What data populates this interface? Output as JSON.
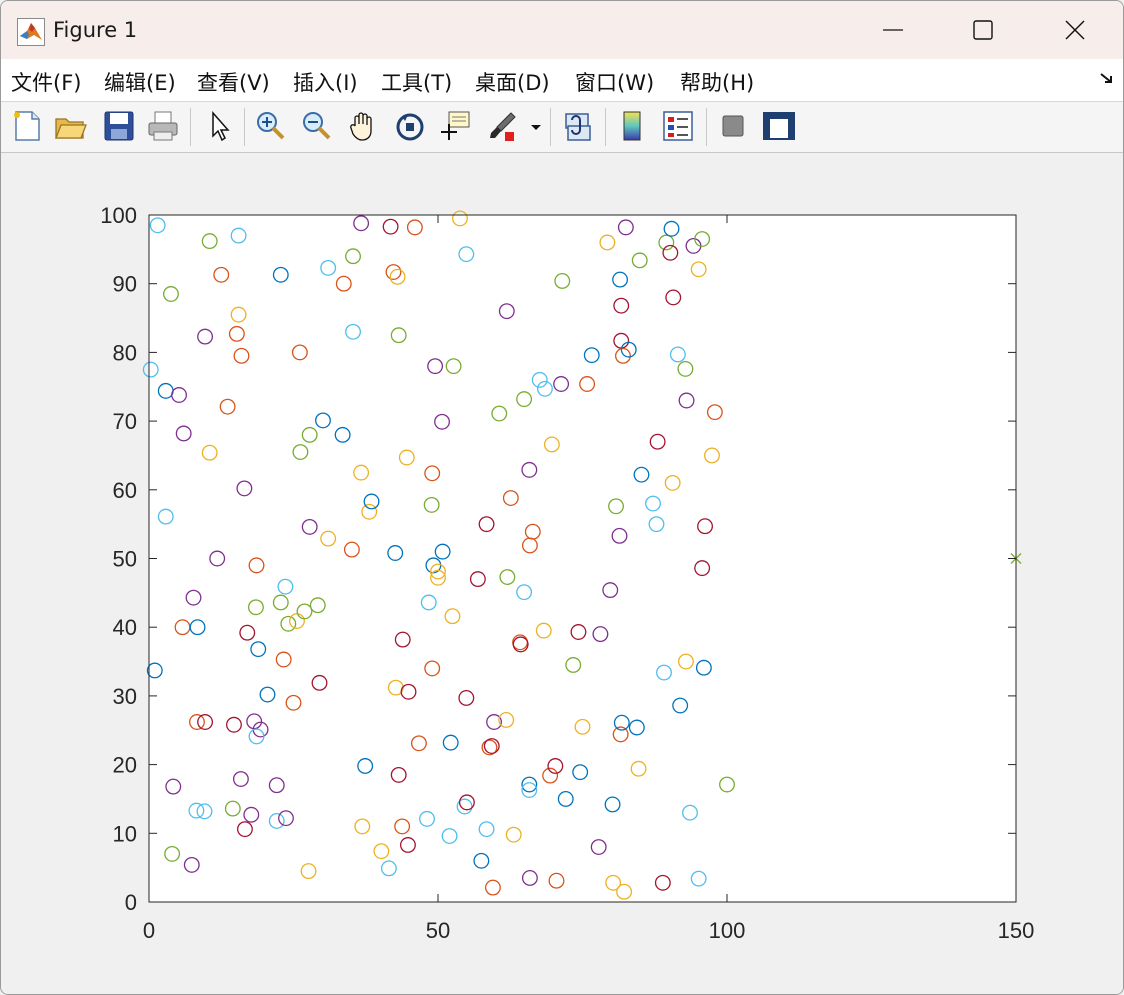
{
  "window": {
    "title": "Figure 1",
    "icon": "matlab-icon",
    "controls": [
      "minimize-icon",
      "maximize-icon",
      "close-icon"
    ]
  },
  "menubar": {
    "items": [
      "文件(F)",
      "编辑(E)",
      "查看(V)",
      "插入(I)",
      "工具(T)",
      "桌面(D)",
      "窗口(W)",
      "帮助(H)"
    ],
    "collapse_icon": "dock-arrow-icon"
  },
  "toolbar": {
    "buttons": [
      "new-figure-icon",
      "open-file-icon",
      "save-icon",
      "print-icon",
      "edit-plot-icon",
      "zoom-in-icon",
      "zoom-out-icon",
      "pan-icon",
      "rotate-3d-icon",
      "data-cursor-icon",
      "brush-icon",
      "link-plot-icon",
      "colorbar-icon",
      "legend-icon",
      "hide-plot-tools-icon",
      "show-plot-tools-icon"
    ]
  },
  "chart_data": {
    "type": "scatter",
    "title": "",
    "xlabel": "",
    "ylabel": "",
    "xlim": [
      0,
      150
    ],
    "ylim": [
      0,
      100
    ],
    "xticks": [
      "0",
      "50",
      "100",
      "150"
    ],
    "yticks": [
      "0",
      "10",
      "20",
      "30",
      "40",
      "50",
      "60",
      "70",
      "80",
      "90",
      "100"
    ],
    "grid": false,
    "marker": "circle",
    "colors": [
      "#0072BD",
      "#D95319",
      "#EDB120",
      "#7E2F8E",
      "#77AC30",
      "#4DBEEE",
      "#A2142F"
    ],
    "points": [
      [
        1.5,
        98.5,
        5
      ],
      [
        10.5,
        96.2,
        4
      ],
      [
        15.5,
        97,
        5
      ],
      [
        22.8,
        91.3,
        0
      ],
      [
        12.5,
        91.3,
        1
      ],
      [
        3.8,
        88.5,
        4
      ],
      [
        31,
        92.3,
        5
      ],
      [
        36.7,
        98.8,
        3
      ],
      [
        35.3,
        94,
        4
      ],
      [
        41.8,
        98.3,
        6
      ],
      [
        46,
        98.2,
        1
      ],
      [
        53.8,
        99.5,
        2
      ],
      [
        54.9,
        94.3,
        5
      ],
      [
        42.3,
        91.7,
        1
      ],
      [
        43,
        91,
        2
      ],
      [
        33.7,
        90,
        1
      ],
      [
        15.5,
        85.5,
        2
      ],
      [
        15.2,
        82.7,
        1
      ],
      [
        9.7,
        82.3,
        3
      ],
      [
        16,
        79.5,
        1
      ],
      [
        35.3,
        83,
        5
      ],
      [
        43.2,
        82.5,
        4
      ],
      [
        49.5,
        78,
        3
      ],
      [
        52.7,
        78,
        4
      ],
      [
        61.9,
        86,
        3
      ],
      [
        71.5,
        90.4,
        4
      ],
      [
        79.3,
        96,
        2
      ],
      [
        82.5,
        98.2,
        3
      ],
      [
        81.5,
        90.6,
        0
      ],
      [
        81.7,
        86.8,
        6
      ],
      [
        89.5,
        96,
        4
      ],
      [
        90.4,
        98,
        0
      ],
      [
        90.2,
        94.5,
        6
      ],
      [
        94.2,
        95.5,
        3
      ],
      [
        95.7,
        96.5,
        4
      ],
      [
        95.1,
        92.1,
        2
      ],
      [
        84.9,
        93.4,
        4
      ],
      [
        90.7,
        88,
        6
      ],
      [
        0.3,
        77.5,
        5
      ],
      [
        2.9,
        74.4,
        0
      ],
      [
        5.2,
        73.8,
        3
      ],
      [
        6,
        68.2,
        3
      ],
      [
        13.6,
        72.1,
        1
      ],
      [
        10.5,
        65.4,
        2
      ],
      [
        26.1,
        80,
        1
      ],
      [
        30.1,
        70.1,
        0
      ],
      [
        27.8,
        68,
        4
      ],
      [
        26.2,
        65.5,
        4
      ],
      [
        33.5,
        68,
        0
      ],
      [
        44.6,
        64.7,
        2
      ],
      [
        36.7,
        62.5,
        2
      ],
      [
        49,
        62.4,
        1
      ],
      [
        50.7,
        69.9,
        3
      ],
      [
        60.6,
        71.1,
        4
      ],
      [
        64.9,
        73.2,
        4
      ],
      [
        67.6,
        76,
        5
      ],
      [
        68.5,
        74.7,
        5
      ],
      [
        71.3,
        75.4,
        3
      ],
      [
        75.8,
        75.4,
        1
      ],
      [
        76.6,
        79.6,
        0
      ],
      [
        81.7,
        81.7,
        6
      ],
      [
        82,
        79.5,
        1
      ],
      [
        83,
        80.4,
        0
      ],
      [
        91.5,
        79.7,
        5
      ],
      [
        92.8,
        77.6,
        4
      ],
      [
        93,
        73,
        3
      ],
      [
        97.9,
        71.3,
        1
      ],
      [
        88,
        67,
        6
      ],
      [
        69.7,
        66.6,
        2
      ],
      [
        65.8,
        62.9,
        3
      ],
      [
        85.2,
        62.2,
        0
      ],
      [
        97.4,
        65,
        2
      ],
      [
        90.6,
        61,
        2
      ],
      [
        2.9,
        56.1,
        5
      ],
      [
        16.5,
        60.2,
        3
      ],
      [
        11.8,
        50,
        3
      ],
      [
        18.6,
        49,
        1
      ],
      [
        27.8,
        54.6,
        3
      ],
      [
        31,
        52.9,
        2
      ],
      [
        35.1,
        51.3,
        1
      ],
      [
        38.1,
        56.8,
        2
      ],
      [
        38.5,
        58.3,
        0
      ],
      [
        42.6,
        50.8,
        0
      ],
      [
        48.9,
        57.8,
        4
      ],
      [
        49.2,
        49,
        0
      ],
      [
        50,
        48.1,
        2
      ],
      [
        50,
        47.2,
        2
      ],
      [
        50.8,
        51,
        0
      ],
      [
        56.9,
        47,
        6
      ],
      [
        58.4,
        55,
        6
      ],
      [
        62.6,
        58.8,
        1
      ],
      [
        65.9,
        51.9,
        1
      ],
      [
        66.4,
        53.9,
        1
      ],
      [
        62,
        47.3,
        4
      ],
      [
        64.9,
        45.1,
        5
      ],
      [
        80.8,
        57.6,
        4
      ],
      [
        81.4,
        53.3,
        3
      ],
      [
        79.8,
        45.4,
        3
      ],
      [
        87.2,
        58,
        5
      ],
      [
        87.8,
        55,
        5
      ],
      [
        96.2,
        54.7,
        6
      ],
      [
        95.7,
        48.6,
        6
      ],
      [
        7.7,
        44.3,
        3
      ],
      [
        5.8,
        40,
        1
      ],
      [
        8.4,
        40,
        0
      ],
      [
        17,
        39.2,
        6
      ],
      [
        18.5,
        42.9,
        4
      ],
      [
        18.9,
        36.8,
        0
      ],
      [
        22.8,
        43.6,
        4
      ],
      [
        23.6,
        45.9,
        5
      ],
      [
        24.1,
        40.5,
        4
      ],
      [
        25.6,
        40.9,
        2
      ],
      [
        26.9,
        42.3,
        4
      ],
      [
        29.2,
        43.2,
        4
      ],
      [
        23.3,
        35.3,
        1
      ],
      [
        20.5,
        30.2,
        0
      ],
      [
        25,
        29,
        1
      ],
      [
        29.5,
        31.9,
        6
      ],
      [
        43.9,
        38.2,
        6
      ],
      [
        48.4,
        43.6,
        5
      ],
      [
        52.5,
        41.6,
        2
      ],
      [
        49,
        34,
        1
      ],
      [
        42.7,
        31.2,
        2
      ],
      [
        44.9,
        30.6,
        6
      ],
      [
        54.9,
        29.7,
        6
      ],
      [
        64.2,
        37.8,
        1
      ],
      [
        64.3,
        37.5,
        6
      ],
      [
        68.3,
        39.5,
        2
      ],
      [
        73.4,
        34.5,
        4
      ],
      [
        74.3,
        39.3,
        6
      ],
      [
        78.1,
        39,
        3
      ],
      [
        92.9,
        35,
        2
      ],
      [
        89.1,
        33.4,
        5
      ],
      [
        96,
        34.1,
        0
      ],
      [
        91.9,
        28.6,
        0
      ],
      [
        1,
        33.7,
        0
      ],
      [
        8.3,
        26.2,
        1
      ],
      [
        9.7,
        26.2,
        6
      ],
      [
        14.7,
        25.8,
        6
      ],
      [
        18.2,
        26.3,
        3
      ],
      [
        19.3,
        25.1,
        3
      ],
      [
        18.6,
        24.1,
        5
      ],
      [
        4.2,
        16.8,
        3
      ],
      [
        15.9,
        17.9,
        3
      ],
      [
        22.1,
        17,
        3
      ],
      [
        37.4,
        19.8,
        0
      ],
      [
        43.2,
        18.5,
        6
      ],
      [
        46.7,
        23.1,
        1
      ],
      [
        52.2,
        23.2,
        0
      ],
      [
        58.9,
        22.5,
        1
      ],
      [
        59.3,
        22.7,
        6
      ],
      [
        59.7,
        26.2,
        3
      ],
      [
        61.8,
        26.5,
        2
      ],
      [
        69.4,
        18.4,
        1
      ],
      [
        70.3,
        19.8,
        6
      ],
      [
        72.1,
        15,
        0
      ],
      [
        74.6,
        18.9,
        0
      ],
      [
        75,
        25.5,
        2
      ],
      [
        81.6,
        24.4,
        1
      ],
      [
        81.8,
        26.1,
        0
      ],
      [
        84.4,
        25.4,
        0
      ],
      [
        84.7,
        19.4,
        2
      ],
      [
        80.2,
        14.2,
        0
      ],
      [
        65.8,
        17.1,
        0
      ],
      [
        65.8,
        16.3,
        5
      ],
      [
        100,
        17.1,
        4
      ],
      [
        8.2,
        13.3,
        5
      ],
      [
        9.6,
        13.2,
        5
      ],
      [
        14.5,
        13.6,
        4
      ],
      [
        16.6,
        10.6,
        6
      ],
      [
        17.7,
        12.7,
        3
      ],
      [
        22.1,
        11.8,
        5
      ],
      [
        23.7,
        12.2,
        3
      ],
      [
        4,
        7,
        4
      ],
      [
        7.4,
        5.4,
        3
      ],
      [
        27.6,
        4.5,
        2
      ],
      [
        36.9,
        11,
        2
      ],
      [
        40.2,
        7.4,
        2
      ],
      [
        41.5,
        4.9,
        5
      ],
      [
        43.8,
        11,
        1
      ],
      [
        44.8,
        8.3,
        6
      ],
      [
        48.1,
        12.1,
        5
      ],
      [
        52,
        9.6,
        5
      ],
      [
        54.6,
        13.9,
        5
      ],
      [
        55,
        14.5,
        6
      ],
      [
        58.4,
        10.6,
        5
      ],
      [
        57.5,
        6,
        0
      ],
      [
        59.5,
        2.1,
        1
      ],
      [
        63.1,
        9.8,
        2
      ],
      [
        65.9,
        3.5,
        3
      ],
      [
        70.5,
        3.1,
        1
      ],
      [
        77.8,
        8,
        3
      ],
      [
        80.3,
        2.8,
        2
      ],
      [
        82.2,
        1.5,
        2
      ],
      [
        88.9,
        2.8,
        6
      ],
      [
        93.6,
        13,
        5
      ],
      [
        95.1,
        3.4,
        5
      ]
    ],
    "extra_point": {
      "x": 150,
      "y": 50,
      "marker": "x",
      "color": "#77AC30"
    }
  }
}
